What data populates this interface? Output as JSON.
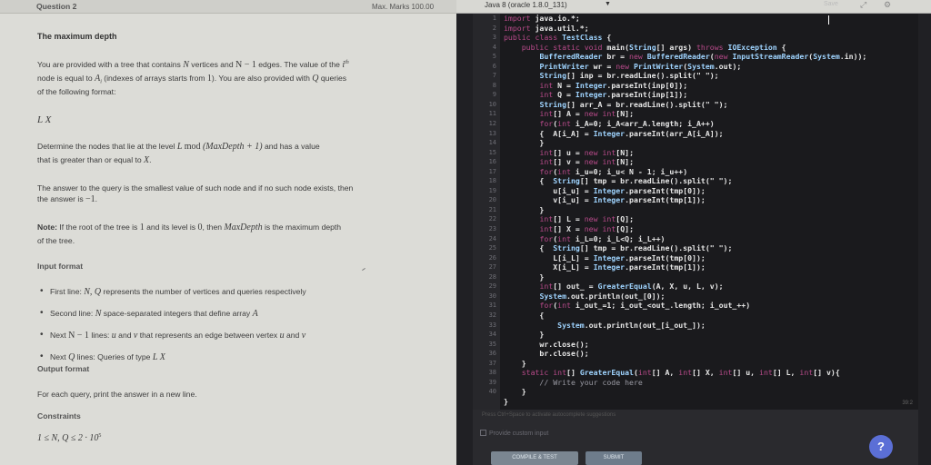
{
  "problem": {
    "question_label": "Question 2",
    "marks": "Max. Marks 100.00",
    "title": "The maximum depth",
    "intro_1": "You are provided with a tree that contains",
    "N": "N",
    "intro_2": "vertices and",
    "N_minus_1": "N − 1",
    "intro_3": "edges. The value of the",
    "ith": "i",
    "ith_sup": "th",
    "intro_4": "node is equal to",
    "Ai": "A",
    "Ai_sub": "i",
    "intro_5": "(indexes of arrays starts from",
    "one": "1",
    "intro_6": "). You are also provided with",
    "Q": "Q",
    "intro_7": "queries",
    "intro_8": "of the following format:",
    "query_format": "L X",
    "det_1": "Determine the nodes that lie at the level",
    "L": "L",
    "mod": "mod",
    "maxdepth_expr": "(MaxDepth + 1)",
    "det_2": "and has a value",
    "det_3": "that is greater than or equal to",
    "X": "X",
    "ans_1": "The answer to the query is the smallest value of such node and if no such node exists, then",
    "ans_2": "the answer is",
    "minus_one": "−1",
    "note_label": "Note:",
    "note_1": "If the root of the tree is",
    "note_2": "and its level is",
    "zero": "0",
    "note_3": ", then",
    "maxdepth": "MaxDepth",
    "note_4": "is the maximum depth",
    "note_5": "of the tree.",
    "input_format": "Input format",
    "bullets": [
      {
        "pre": "First line:",
        "math": "N, Q",
        "post": "represents the number of vertices and queries respectively"
      },
      {
        "pre": "Second line:",
        "math": "N",
        "post": "space-separated integers that define array",
        "math2": "A"
      },
      {
        "pre": "Next",
        "math": "N − 1",
        "post": "lines:",
        "math2": "u",
        "post2": "and",
        "math3": "v",
        "post3": "that represents an edge between vertex",
        "math4": "u",
        "post4": "and",
        "math5": "v"
      },
      {
        "pre": "Next",
        "math": "Q",
        "post": "lines: Queries of type",
        "math2": "L X"
      }
    ],
    "output_format": "Output format",
    "output_text": "For each query, print the answer in a new line.",
    "constraints": "Constraints",
    "constraint_expr": "1 ≤ N, Q ≤ 2 · 10",
    "constraint_sup": "5"
  },
  "editor": {
    "language": "Java 8 (oracle 1.8.0_131)",
    "save_label": "Save",
    "hint_text": "Press Ctrl+Space to activate autocomplete suggestions",
    "cursor_pos": "39:2",
    "custom_input_label": "Provide custom input",
    "compile_label": "COMPILE & TEST",
    "submit_label": "SUBMIT",
    "help_label": "?",
    "line_numbers": [
      "1",
      "2",
      "3",
      "4",
      "5",
      "6",
      "7",
      "8",
      "9",
      "10",
      "11",
      "12",
      "13",
      "14",
      "15",
      "16",
      "17",
      "18",
      "19",
      "20",
      "21",
      "22",
      "23",
      "24",
      "25",
      "26",
      "27",
      "28",
      "29",
      "30",
      "31",
      "32",
      "33",
      "34",
      "35",
      "36",
      "37",
      "38",
      "39",
      "40"
    ],
    "code_lines": [
      "import java.io.*;",
      "import java.util.*;",
      "public class TestClass {",
      "    public static void main(String[] args) throws IOException {",
      "        BufferedReader br = new BufferedReader(new InputStreamReader(System.in));",
      "        PrintWriter wr = new PrintWriter(System.out);",
      "        String[] inp = br.readLine().split(\" \");",
      "        int N = Integer.parseInt(inp[0]);",
      "        int Q = Integer.parseInt(inp[1]);",
      "        String[] arr_A = br.readLine().split(\" \");",
      "        int[] A = new int[N];",
      "        for(int i_A=0; i_A<arr_A.length; i_A++)",
      "        {  A[i_A] = Integer.parseInt(arr_A[i_A]);",
      "        }",
      "        int[] u = new int[N];",
      "        int[] v = new int[N];",
      "        for(int i_u=0; i_u< N - 1; i_u++)",
      "        {  String[] tmp = br.readLine().split(\" \");",
      "           u[i_u] = Integer.parseInt(tmp[0]);",
      "           v[i_u] = Integer.parseInt(tmp[1]);",
      "        }",
      "        int[] L = new int[Q];",
      "        int[] X = new int[Q];",
      "        for(int i_L=0; i_L<Q; i_L++)",
      "        {  String[] tmp = br.readLine().split(\" \");",
      "           L[i_L] = Integer.parseInt(tmp[0]);",
      "           X[i_L] = Integer.parseInt(tmp[1]);",
      "        }",
      "        int[] out_ = GreaterEqual(A, X, u, L, v);",
      "        System.out.println(out_[0]);",
      "        for(int i_out_=1; i_out_<out_.length; i_out_++)",
      "        {",
      "            System.out.println(out_[i_out_]);",
      "        }",
      "        wr.close();",
      "        br.close();",
      "    }",
      "    static int[] GreaterEqual(int[] A, int[] X, int[] u, int[] L, int[] v){",
      "        // Write your code here",
      "    }",
      "}"
    ]
  }
}
